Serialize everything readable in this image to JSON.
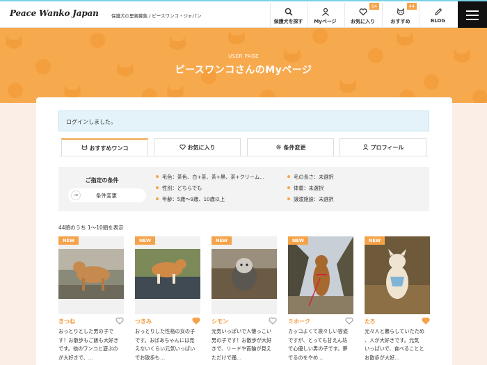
{
  "header": {
    "logo": "Peace Wanko Japan",
    "tagline": "保護犬の里親募集 / ピースワンコ・ジャパン",
    "nav": [
      {
        "label": "保護犬を探す",
        "icon": "search-icon",
        "badge": ""
      },
      {
        "label": "Myページ",
        "icon": "user-icon",
        "badge": ""
      },
      {
        "label": "お気に入り",
        "icon": "heart-icon",
        "badge": "14"
      },
      {
        "label": "おすすめ",
        "icon": "dog-face-icon",
        "badge": "44"
      },
      {
        "label": "BLOG",
        "icon": "pen-icon",
        "badge": ""
      }
    ]
  },
  "hero": {
    "subtitle": "USER PAGE",
    "title": "ピースワンコさんのMyページ"
  },
  "alert": "ログインしました。",
  "tabs": [
    {
      "label": "おすすめワンコ",
      "icon": "dog-face-icon"
    },
    {
      "label": "お気に入り",
      "icon": "heart-icon"
    },
    {
      "label": "条件変更",
      "icon": "gear-icon"
    },
    {
      "label": "プロフィール",
      "icon": "user-icon"
    }
  ],
  "conditions": {
    "title": "ご指定の条件",
    "button": "条件変更",
    "left": [
      "毛色：茶色、白+茶、茶+黒、茶+クリーム…",
      "性別：どちらでも",
      "年齢：5歳〜9歳、10歳以上"
    ],
    "right": [
      "毛の長さ：未選択",
      "体重：未選択",
      "譲渡施設：未選択"
    ]
  },
  "count_text": "44頭のうち 1〜10頭を表示",
  "dogs": [
    {
      "badge": "NEW",
      "name": "きつね",
      "favorited": false,
      "desc": [
        "おっとりとした男の子で",
        "す！お散歩もご飯も大好き",
        "です。他のワンコと遊ぶの",
        "が大好きで、…"
      ]
    },
    {
      "badge": "NEW",
      "name": "つきみ",
      "favorited": true,
      "desc": [
        "おっとりした性格の女の子",
        "です。おばあちゃんには見",
        "えないくらい元気いっぱい",
        "でお散歩も…"
      ]
    },
    {
      "badge": "NEW",
      "name": "シモン",
      "favorited": false,
      "desc": [
        "元気いっぱいで人懐っこい",
        "男の子です！お散歩が大好",
        "きで、リードや首輪が見え",
        "ただけで踊…"
      ]
    },
    {
      "badge": "NEW",
      "name": "ミホーク",
      "favorited": false,
      "desc": [
        "カッコよくて凛々しい容姿",
        "ですが、とっても甘えん坊",
        "で心優しい男の子です。夢",
        "でるのをやめ…"
      ]
    },
    {
      "badge": "NEW",
      "name": "たろ",
      "favorited": true,
      "desc": [
        "元々人と暮らしていたため",
        "、人が大好きです。元気",
        "いっぱいで、食べることと",
        "お散歩が大好…"
      ]
    }
  ],
  "colors": {
    "accent": "#f5a34a",
    "hero": "#f7a94d",
    "name": "#f19a3a",
    "alert_bg": "#e3f3f9"
  }
}
